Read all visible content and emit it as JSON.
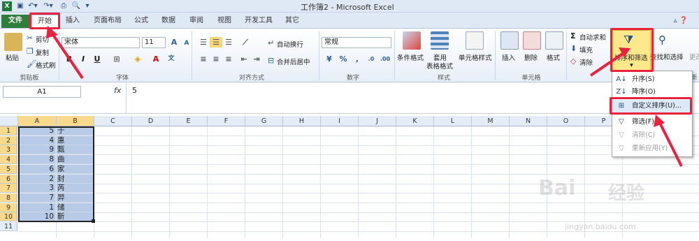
{
  "window": {
    "title": "工作簿2 - Microsoft Excel"
  },
  "quick_access": {
    "save_icon": "save-icon",
    "undo_icon": "undo-icon",
    "redo_icon": "redo-icon",
    "print_icon": "print-preview-icon"
  },
  "tabs": [
    "文件",
    "开始",
    "插入",
    "页面布局",
    "公式",
    "数据",
    "审阅",
    "视图",
    "开发工具",
    "其它"
  ],
  "ribbon": {
    "clipboard": {
      "paste": "粘贴",
      "cut": "剪切",
      "copy": "复制",
      "format_painter": "格式刷",
      "label": "剪贴板"
    },
    "font": {
      "name": "宋体",
      "size": "11",
      "bold": "B",
      "italic": "I",
      "underline": "U",
      "label": "字体"
    },
    "alignment": {
      "wrap": "自动换行",
      "merge": "合并后居中",
      "label": "对齐方式"
    },
    "number": {
      "format": "常规",
      "label": "数字"
    },
    "styles": {
      "conditional": "条件格式",
      "table1": "套用",
      "table2": "表格格式",
      "cell_style": "单元格样式",
      "label": "样式"
    },
    "cells": {
      "insert": "插入",
      "delete": "删除",
      "format": "格式",
      "label": "单元格"
    },
    "editing": {
      "autosum": "自动求和",
      "fill": "填充",
      "clear": "清除",
      "sort_filter": "排序和筛选",
      "find_select": "查找和选择",
      "more": "更改",
      "label": "新"
    }
  },
  "formula_bar": {
    "name_box": "A1",
    "fx": "fx",
    "content": "5"
  },
  "columns": [
    "A",
    "B",
    "C",
    "D",
    "E",
    "F",
    "G",
    "H",
    "I",
    "J",
    "K",
    "L",
    "M",
    "N",
    "O",
    "P"
  ],
  "rows": [
    {
      "n": "1",
      "a": "5",
      "b": "于"
    },
    {
      "n": "2",
      "a": "4",
      "b": "惠"
    },
    {
      "n": "3",
      "a": "9",
      "b": "甄"
    },
    {
      "n": "4",
      "a": "8",
      "b": "曲"
    },
    {
      "n": "5",
      "a": "6",
      "b": "家"
    },
    {
      "n": "6",
      "a": "2",
      "b": "封"
    },
    {
      "n": "7",
      "a": "3",
      "b": "芮"
    },
    {
      "n": "8",
      "a": "7",
      "b": "羿"
    },
    {
      "n": "9",
      "a": "1",
      "b": "储"
    },
    {
      "n": "10",
      "a": "10",
      "b": "靳"
    },
    {
      "n": "11",
      "a": "",
      "b": ""
    }
  ],
  "sort_menu": {
    "asc": "升序(S)",
    "desc": "降序(O)",
    "custom": "自定义排序(U)...",
    "filter": "筛选(F)",
    "clear": "清除(C)",
    "reapply": "重新应用(Y)"
  },
  "watermark": {
    "brand": "Bai",
    "cn": "经验",
    "url": "jingyan.baidu.com"
  },
  "colors": {
    "highlight_red": "#e8233f",
    "selection_blue": "#b7cbe7",
    "file_tab_green": "#2f7e3b"
  }
}
